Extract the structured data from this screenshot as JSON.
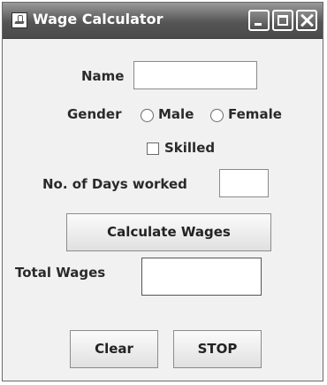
{
  "window": {
    "title": "Wage Calculator",
    "icon": "java-cup-icon"
  },
  "titlebar_buttons": [
    "minimize-icon",
    "maximize-icon",
    "close-icon"
  ],
  "form": {
    "name_label": "Name",
    "name_value": "",
    "gender_label": "Gender",
    "gender_options": [
      "Male",
      "Female"
    ],
    "gender_selected": null,
    "skilled_label": "Skilled",
    "skilled_checked": false,
    "days_label": "No. of Days worked",
    "days_value": "",
    "calculate_label": "Calculate Wages",
    "total_label": "Total Wages",
    "total_value": "",
    "clear_label": "Clear",
    "stop_label": "STOP"
  }
}
